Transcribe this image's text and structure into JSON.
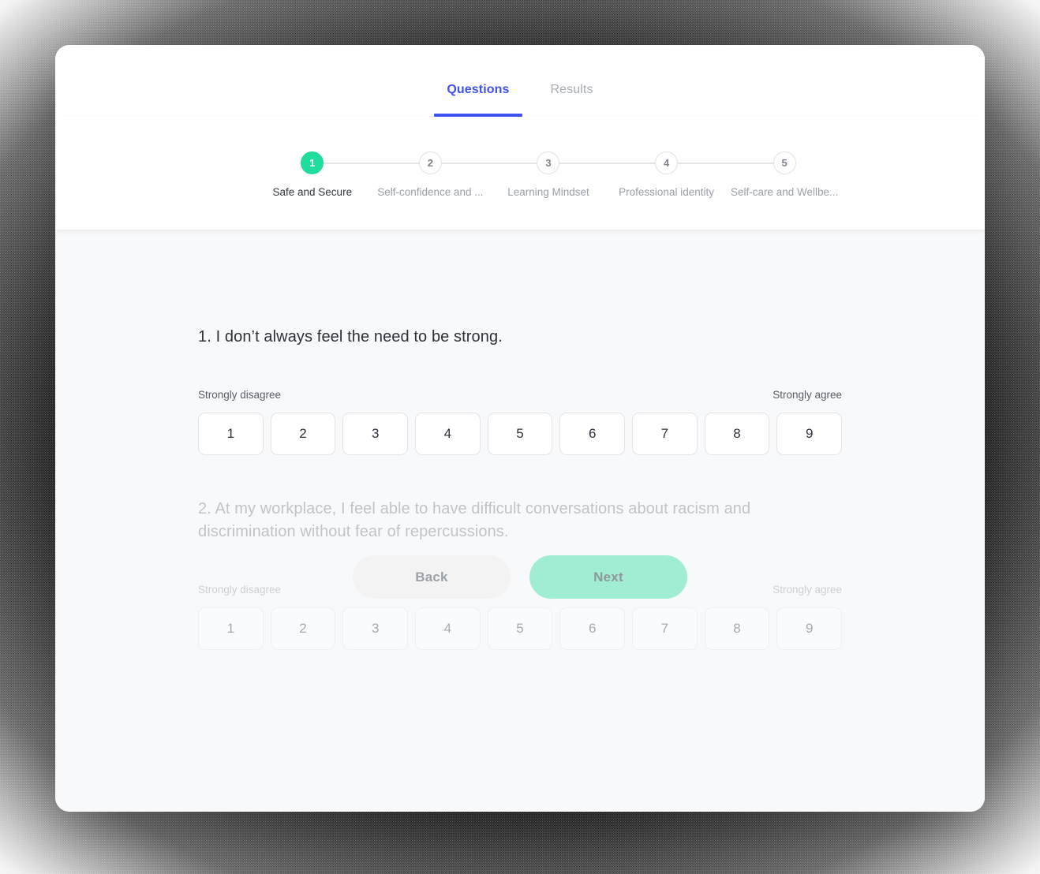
{
  "tabs": [
    {
      "label": "Questions",
      "active": true
    },
    {
      "label": "Results",
      "active": false
    }
  ],
  "stepper": {
    "steps": [
      {
        "number": "1",
        "label": "Safe and Secure",
        "state": "active"
      },
      {
        "number": "2",
        "label": "Self-confidence and ...",
        "state": "upcoming"
      },
      {
        "number": "3",
        "label": "Learning Mindset",
        "state": "upcoming"
      },
      {
        "number": "4",
        "label": "Professional identity",
        "state": "upcoming"
      },
      {
        "number": "5",
        "label": "Self-care and Wellbe...",
        "state": "upcoming"
      }
    ]
  },
  "questions": [
    {
      "number": "1.",
      "text": "I don’t always feel the need to be strong.",
      "scale_low_label": "Strongly disagree",
      "scale_high_label": "Strongly agree",
      "options": [
        "1",
        "2",
        "3",
        "4",
        "5",
        "6",
        "7",
        "8",
        "9"
      ],
      "selected": null
    },
    {
      "number": "2.",
      "text": "At my workplace, I feel able to have difficult conversations about racism and discrimination without fear of repercussions.",
      "scale_low_label": "Strongly disagree",
      "scale_high_label": "Strongly agree",
      "options": [
        "1",
        "2",
        "3",
        "4",
        "5",
        "6",
        "7",
        "8",
        "9"
      ],
      "selected": null
    }
  ],
  "navigation": {
    "back_label": "Back",
    "next_label": "Next"
  },
  "colors": {
    "accent_blue": "#3f51f3",
    "step_active_green": "#1fdd9a",
    "next_button_green": "#a0edd3",
    "page_background": "#f8f9fa",
    "card_background": "#ffffff"
  }
}
